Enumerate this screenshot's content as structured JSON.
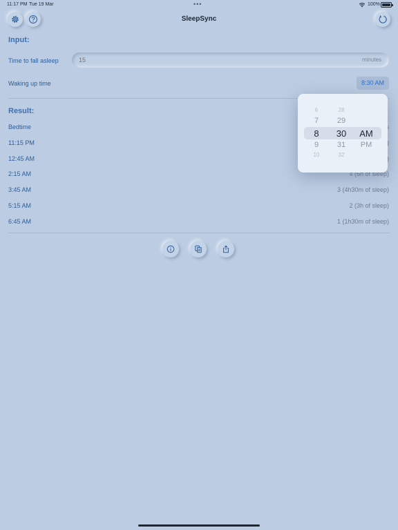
{
  "status_bar": {
    "time": "11:17 PM",
    "date": "Tue 19 Mar",
    "dots": "•••",
    "battery": "100%"
  },
  "header": {
    "title": "SleepSync",
    "icons": {
      "settings": "gear-icon",
      "help": "question-icon",
      "reset": "refresh-icon"
    }
  },
  "input_section": {
    "heading": "Input:",
    "fall_asleep": {
      "label": "Time to fall asleep",
      "value": "15",
      "placeholder": "15",
      "unit": "minutes"
    },
    "wakeup": {
      "label": "Waking up time",
      "value": "8:30 AM"
    }
  },
  "result_section": {
    "heading": "Result:",
    "header_row": {
      "time": "Bedtime",
      "cycles": "s"
    },
    "rows": [
      {
        "time": "11:15 PM",
        "cycles": ")"
      },
      {
        "time": "12:45 AM",
        "cycles": ")"
      },
      {
        "time": "2:15 AM",
        "cycles": "4 (6h of sleep)"
      },
      {
        "time": "3:45 AM",
        "cycles": "3 (4h30m of sleep)"
      },
      {
        "time": "5:15 AM",
        "cycles": "2 (3h of sleep)"
      },
      {
        "time": "6:45 AM",
        "cycles": "1 (1h30m of sleep)"
      }
    ]
  },
  "actions": {
    "icons": [
      "info-icon",
      "copy-icon",
      "share-icon"
    ]
  },
  "picker": {
    "hours": [
      "6",
      "7",
      "8",
      "9",
      "10"
    ],
    "minutes": [
      "28",
      "29",
      "30",
      "31",
      "32"
    ],
    "periods": [
      "AM",
      "PM"
    ],
    "selected": {
      "hour": "8",
      "minute": "30",
      "period": "AM"
    }
  },
  "colors": {
    "background": "#bccde3",
    "accent": "#2f6ed4",
    "label": "#2d5d99"
  }
}
